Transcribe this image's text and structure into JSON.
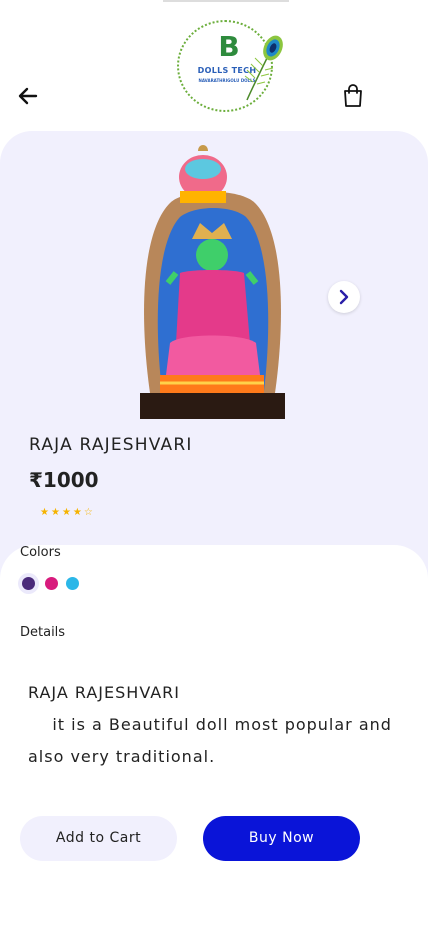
{
  "brand": {
    "name": "DOLLS TECH",
    "tagline": "NAVARATHRIGOLU DOLLS",
    "logo_letter": "B",
    "logo_icon": "peacock-feather-icon"
  },
  "header": {
    "back_icon": "arrow-left-icon",
    "bag_icon": "shopping-bag-icon"
  },
  "product": {
    "title": "RAJA RAJESHVARI",
    "price": "₹1000",
    "rating": 4,
    "rating_max": 5,
    "image_icon": "doll-figurine-image",
    "next_icon": "chevron-right-icon"
  },
  "colors": {
    "label": "Colors",
    "options": [
      "#4a2a7a",
      "#d81b7d",
      "#2bb7e8"
    ],
    "selected_index": 0
  },
  "details": {
    "label": "Details",
    "line1": "RAJA RAJESHVARI",
    "line2": "it is a Beautiful doll most popular and",
    "line3": "also very traditional."
  },
  "actions": {
    "add_to_cart": "Add to Cart",
    "buy_now": "Buy Now"
  },
  "theme": {
    "accent": "#0a14d8",
    "hero_bg": "#f1f0fd",
    "star_color": "#f5b301"
  }
}
